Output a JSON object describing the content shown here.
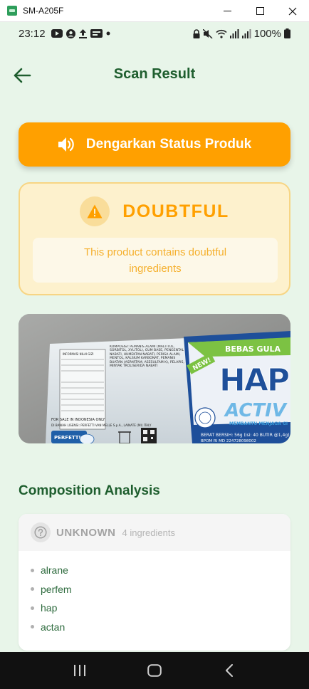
{
  "window": {
    "title": "SM-A205F",
    "minimize_glyph": "—",
    "maximize_glyph": "☐",
    "close_glyph": "✕"
  },
  "statusbar": {
    "time": "23:12",
    "battery": "100%",
    "left_icons": [
      "youtube-icon",
      "account-circle-icon",
      "upload-icon",
      "media-icon",
      "dot"
    ],
    "right_icons": [
      "lock-icon",
      "mute-icon",
      "wifi-icon",
      "signal-icon",
      "signal-icon",
      "battery-icon"
    ]
  },
  "appbar": {
    "title": "Scan Result"
  },
  "listen_button": {
    "label": "Dengarkan Status Produk"
  },
  "status_card": {
    "status": "DOUBTFUL",
    "message": "This product contains doubtful ingredients"
  },
  "product_photo": {
    "brand_text": "HAPP",
    "sub_brand": "ACTIV",
    "banner": "BEBAS GULA",
    "badge": "NEW!",
    "tagline": "MEMBANTU MENJAGA GI",
    "label_heading": "INFORMASI NILAI GIZI",
    "composition_text": "KOMPOSISI: PEMANIS ALAMI (MALTITOL, SORBITOL, XYLITOL), GUM BASE, PENGENTAL NABATI, HUMEKTAN NABATI, PERISA ALAMI, MENTOL, KALSIUM KARBONAT, PEMANIS BUATAN (ASPARTAM, ASESULFAM K), PELAPIS, MINYAK TROLISERIDA NABATI",
    "weight_text": "BERAT BERSIH: 56g (isi: 40 BUTIR @1,4g)",
    "bpom_text": "BPOM RI MD 224728098002",
    "maker_text": "DI BAWAH LISENSI: PERFETTI VAN MELLE S.p.A., LAINATE (MI) ITALY",
    "sale_text": "FOR SALE IN INDONESIA ONLY",
    "perfetti": "PERFETTI"
  },
  "composition": {
    "title": "Composition Analysis",
    "status": "UNKNOWN",
    "count_text": "4 ingredients",
    "ingredients": [
      "alrane",
      "perfem",
      "hap",
      "actan"
    ]
  },
  "colors": {
    "background": "#e8f5e9",
    "primary_green": "#1e5e2e",
    "accent_orange": "#ffa000",
    "doubtful_bg": "#fdf1cd",
    "doubtful_border": "#f7d584"
  }
}
